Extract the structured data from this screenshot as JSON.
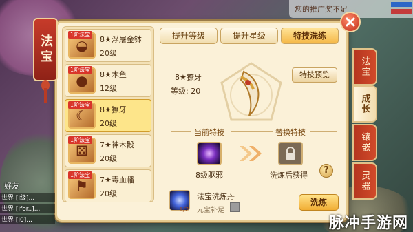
{
  "hud": {
    "notice": "您的推广奖不足"
  },
  "window": {
    "title": "法宝"
  },
  "items": [
    {
      "name": "8★浮屠金钵",
      "level": "20级",
      "tag": "1阶法宝",
      "icon": "golden-bowl-icon"
    },
    {
      "name": "8★木鱼",
      "level": "12级",
      "tag": "1阶法宝",
      "icon": "wooden-fish-icon"
    },
    {
      "name": "8★獠牙",
      "level": "20级",
      "tag": "1阶法宝",
      "icon": "fang-icon",
      "selected": true
    },
    {
      "name": "7★神木骰",
      "level": "20级",
      "tag": "1阶法宝",
      "icon": "dice-icon"
    },
    {
      "name": "7★毒血幡",
      "level": "20级",
      "tag": "1阶法宝",
      "icon": "banner-icon"
    }
  ],
  "tabs": [
    {
      "label": "提升等级"
    },
    {
      "label": "提升星级"
    },
    {
      "label": "特技洗练",
      "active": true
    }
  ],
  "detail": {
    "name": "8★獠牙",
    "level": "等级: 20",
    "preview_button": "特技预览",
    "current_skill_title": "当前特技",
    "replace_skill_title": "替换特技",
    "current_skill": "8级驱邪",
    "replace_skill": "洗炼后获得",
    "item_name": "法宝洗炼丹",
    "item_count": "1/2",
    "auto_fill": "元宝补足",
    "wash_button": "洗炼"
  },
  "side_tabs": [
    {
      "label": "法宝"
    },
    {
      "label": "成长",
      "active": true
    },
    {
      "label": "镶嵌"
    },
    {
      "label": "灵器"
    }
  ],
  "bottom": {
    "friends_label": "好友",
    "chat": [
      "世界 [I级]...",
      "世界 [Ifor..]...",
      "世界 [I0]..."
    ]
  },
  "watermark": "脉冲手游网",
  "colors": {
    "accent": "#f5b846",
    "panel": "#fbf1d8",
    "side_tab": "#c63b2a"
  }
}
